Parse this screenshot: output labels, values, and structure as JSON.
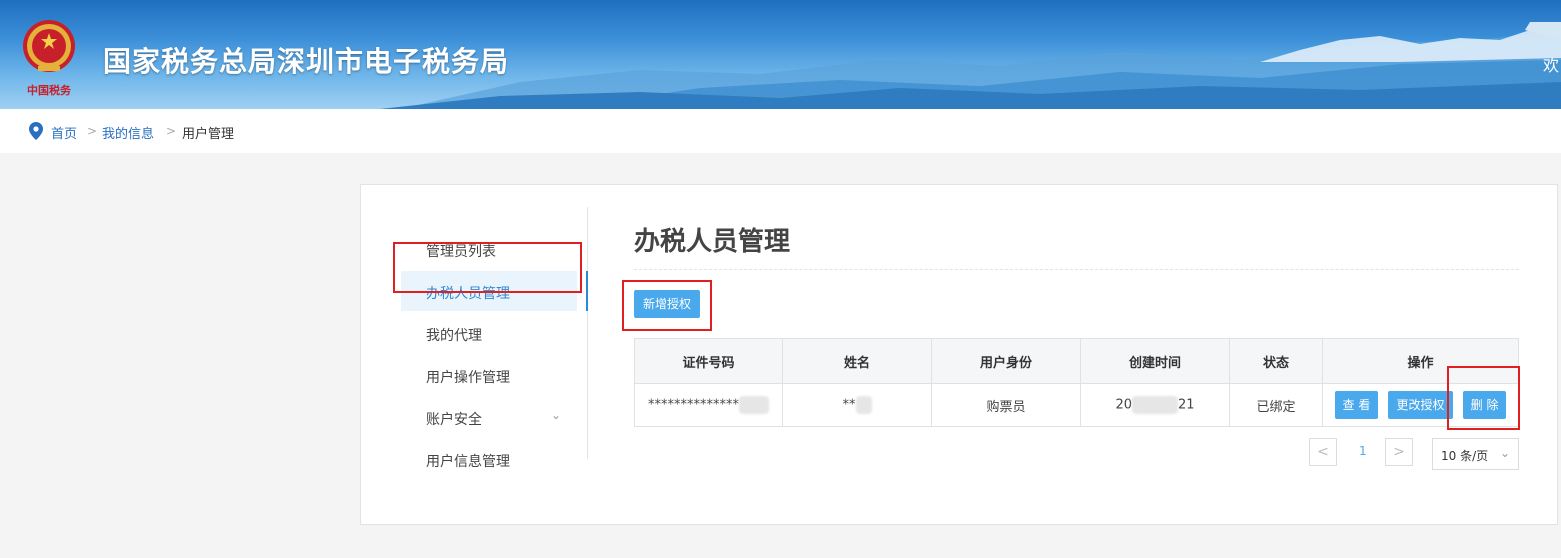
{
  "header": {
    "site_title": "国家税务总局深圳市电子税务局",
    "emblem_caption": "中国税务",
    "welcome_text": "欢"
  },
  "breadcrumb": [
    {
      "label": "首页"
    },
    {
      "label": "我的信息"
    },
    {
      "label": "用户管理"
    }
  ],
  "breadcrumb_separator": ">",
  "sidebar": {
    "items": [
      {
        "label": "管理员列表"
      },
      {
        "label": "办税人员管理",
        "active": true
      },
      {
        "label": "我的代理"
      },
      {
        "label": "用户操作管理"
      },
      {
        "label": "账户安全",
        "has_submenu": true
      },
      {
        "label": "用户信息管理"
      }
    ],
    "chevron": "⌄"
  },
  "main": {
    "title": "办税人员管理",
    "add_button": "新增授权",
    "table": {
      "columns": [
        "证件号码",
        "姓名",
        "用户身份",
        "创建时间",
        "状态",
        "操作"
      ],
      "rows": [
        {
          "id_number": "**************",
          "name": "**",
          "role": "购票员",
          "created_prefix": "20",
          "created_suffix": "21",
          "status": "已绑定",
          "actions": [
            "查 看",
            "更改授权",
            "删 除"
          ]
        }
      ]
    },
    "pagination": {
      "prev": "<",
      "current_page": "1",
      "next": ">",
      "page_size": "10 条/页",
      "size_chevron": "⌄"
    }
  },
  "colors": {
    "primary": "#4aa8ec",
    "link": "#2a6fc2",
    "highlight": "#e02020"
  }
}
